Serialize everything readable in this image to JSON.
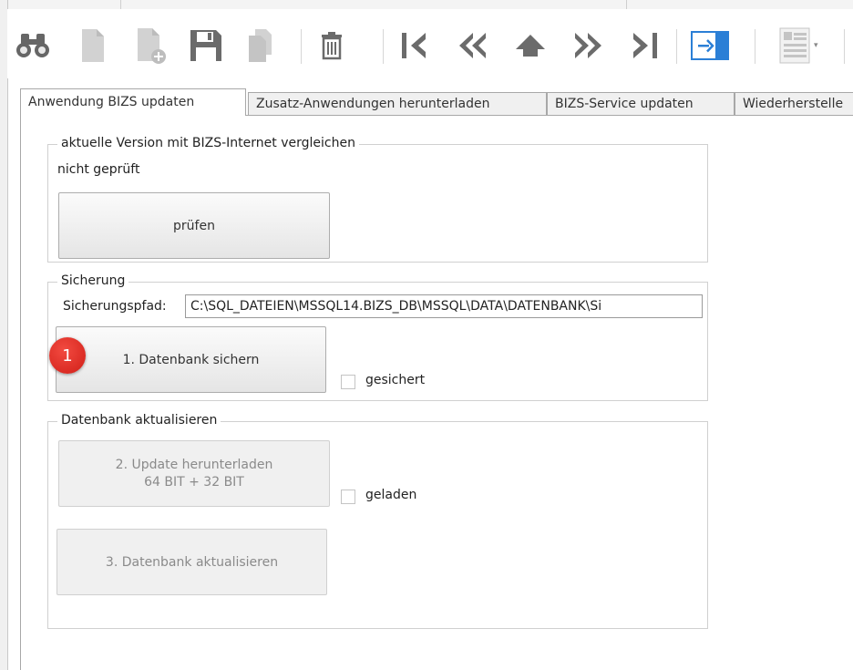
{
  "tabs": [
    {
      "label": "Anwendung BIZS updaten",
      "active": true
    },
    {
      "label": "Zusatz-Anwendungen herunterladen"
    },
    {
      "label": "BIZS-Service updaten"
    },
    {
      "label": "Wiederherstelle"
    }
  ],
  "version_group": {
    "title": "aktuelle Version mit BIZS-Internet vergleichen",
    "status": "nicht geprüft",
    "check_button": "prüfen"
  },
  "backup_group": {
    "title": "Sicherung",
    "path_label": "Sicherungspfad:",
    "path_value": "C:\\SQL_DATEIEN\\MSSQL14.BIZS_DB\\MSSQL\\DATA\\DATENBANK\\Si",
    "backup_button": "1. Datenbank sichern",
    "badge": "1",
    "checkbox_label": "gesichert"
  },
  "update_group": {
    "title": "Datenbank aktualisieren",
    "download_button_line1": "2. Update herunterladen",
    "download_button_line2": "64 BIT + 32 BIT",
    "checkbox_label": "geladen",
    "update_button": "3. Datenbank aktualisieren"
  },
  "colors": {
    "accent": "#2b7fd6",
    "badge": "#d9241c",
    "icon": "#6b6b6b",
    "icon_disabled": "#c9c9c9"
  }
}
